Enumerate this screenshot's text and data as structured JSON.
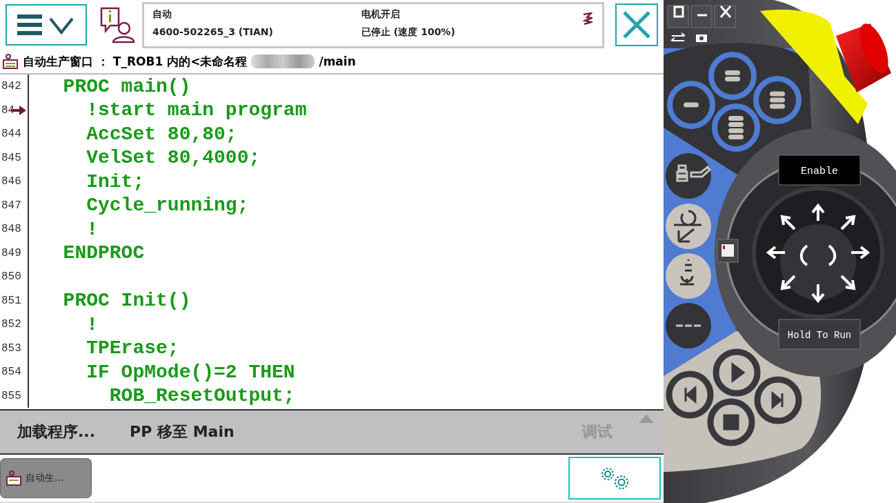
{
  "status": {
    "mode": "自动",
    "system": "4600-502265_3 (TIAN)",
    "motors": "电机开启",
    "program_state": "已停止 (速度 100%)"
  },
  "window_title": {
    "prefix": "自动生产窗口 ： T_ROB1 内的<未命名程",
    "suffix": "/main"
  },
  "code": {
    "lines": [
      {
        "number": "842",
        "text": "  PROC main()",
        "program_pointer": false
      },
      {
        "number": "84",
        "text": "    !start main program",
        "program_pointer": true
      },
      {
        "number": "844",
        "text": "    AccSet 80,80;",
        "program_pointer": false
      },
      {
        "number": "845",
        "text": "    VelSet 80,4000;",
        "program_pointer": false
      },
      {
        "number": "846",
        "text": "    Init;",
        "program_pointer": false
      },
      {
        "number": "847",
        "text": "    Cycle_running;",
        "program_pointer": false
      },
      {
        "number": "848",
        "text": "    !",
        "program_pointer": false
      },
      {
        "number": "849",
        "text": "  ENDPROC",
        "program_pointer": false
      },
      {
        "number": "850",
        "program_pointer": false
      },
      {
        "number": "851",
        "text": "  PROC Init()",
        "program_pointer": false
      },
      {
        "number": "852",
        "text": "    !",
        "program_pointer": false
      },
      {
        "number": "853",
        "text": "    TPErase;",
        "program_pointer": false
      },
      {
        "number": "854",
        "text": "    IF OpMode()=2 THEN",
        "program_pointer": false
      },
      {
        "number": "855",
        "text": "      ROB_ResetOutput;",
        "program_pointer": false
      }
    ]
  },
  "commands": [
    {
      "label": "加载程序...",
      "disabled": false
    },
    {
      "label": "PP 移至 Main",
      "disabled": false
    },
    {
      "label": "调试",
      "disabled": true
    }
  ],
  "taskbar": {
    "tasks": [
      {
        "label": "自动生...",
        "selected": true
      }
    ]
  },
  "pendant": {
    "enable_label": "Enable",
    "hold_to_run_label": "Hold To Run"
  }
}
